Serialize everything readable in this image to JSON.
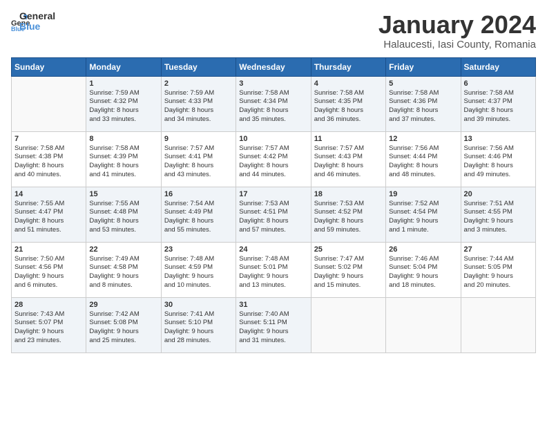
{
  "logo": {
    "text_general": "General",
    "text_blue": "Blue"
  },
  "header": {
    "month": "January 2024",
    "location": "Halaucesti, Iasi County, Romania"
  },
  "weekdays": [
    "Sunday",
    "Monday",
    "Tuesday",
    "Wednesday",
    "Thursday",
    "Friday",
    "Saturday"
  ],
  "weeks": [
    [
      {
        "day": "",
        "info": ""
      },
      {
        "day": "1",
        "info": "Sunrise: 7:59 AM\nSunset: 4:32 PM\nDaylight: 8 hours\nand 33 minutes."
      },
      {
        "day": "2",
        "info": "Sunrise: 7:59 AM\nSunset: 4:33 PM\nDaylight: 8 hours\nand 34 minutes."
      },
      {
        "day": "3",
        "info": "Sunrise: 7:58 AM\nSunset: 4:34 PM\nDaylight: 8 hours\nand 35 minutes."
      },
      {
        "day": "4",
        "info": "Sunrise: 7:58 AM\nSunset: 4:35 PM\nDaylight: 8 hours\nand 36 minutes."
      },
      {
        "day": "5",
        "info": "Sunrise: 7:58 AM\nSunset: 4:36 PM\nDaylight: 8 hours\nand 37 minutes."
      },
      {
        "day": "6",
        "info": "Sunrise: 7:58 AM\nSunset: 4:37 PM\nDaylight: 8 hours\nand 39 minutes."
      }
    ],
    [
      {
        "day": "7",
        "info": "Sunrise: 7:58 AM\nSunset: 4:38 PM\nDaylight: 8 hours\nand 40 minutes."
      },
      {
        "day": "8",
        "info": "Sunrise: 7:58 AM\nSunset: 4:39 PM\nDaylight: 8 hours\nand 41 minutes."
      },
      {
        "day": "9",
        "info": "Sunrise: 7:57 AM\nSunset: 4:41 PM\nDaylight: 8 hours\nand 43 minutes."
      },
      {
        "day": "10",
        "info": "Sunrise: 7:57 AM\nSunset: 4:42 PM\nDaylight: 8 hours\nand 44 minutes."
      },
      {
        "day": "11",
        "info": "Sunrise: 7:57 AM\nSunset: 4:43 PM\nDaylight: 8 hours\nand 46 minutes."
      },
      {
        "day": "12",
        "info": "Sunrise: 7:56 AM\nSunset: 4:44 PM\nDaylight: 8 hours\nand 48 minutes."
      },
      {
        "day": "13",
        "info": "Sunrise: 7:56 AM\nSunset: 4:46 PM\nDaylight: 8 hours\nand 49 minutes."
      }
    ],
    [
      {
        "day": "14",
        "info": "Sunrise: 7:55 AM\nSunset: 4:47 PM\nDaylight: 8 hours\nand 51 minutes."
      },
      {
        "day": "15",
        "info": "Sunrise: 7:55 AM\nSunset: 4:48 PM\nDaylight: 8 hours\nand 53 minutes."
      },
      {
        "day": "16",
        "info": "Sunrise: 7:54 AM\nSunset: 4:49 PM\nDaylight: 8 hours\nand 55 minutes."
      },
      {
        "day": "17",
        "info": "Sunrise: 7:53 AM\nSunset: 4:51 PM\nDaylight: 8 hours\nand 57 minutes."
      },
      {
        "day": "18",
        "info": "Sunrise: 7:53 AM\nSunset: 4:52 PM\nDaylight: 8 hours\nand 59 minutes."
      },
      {
        "day": "19",
        "info": "Sunrise: 7:52 AM\nSunset: 4:54 PM\nDaylight: 9 hours\nand 1 minute."
      },
      {
        "day": "20",
        "info": "Sunrise: 7:51 AM\nSunset: 4:55 PM\nDaylight: 9 hours\nand 3 minutes."
      }
    ],
    [
      {
        "day": "21",
        "info": "Sunrise: 7:50 AM\nSunset: 4:56 PM\nDaylight: 9 hours\nand 6 minutes."
      },
      {
        "day": "22",
        "info": "Sunrise: 7:49 AM\nSunset: 4:58 PM\nDaylight: 9 hours\nand 8 minutes."
      },
      {
        "day": "23",
        "info": "Sunrise: 7:48 AM\nSunset: 4:59 PM\nDaylight: 9 hours\nand 10 minutes."
      },
      {
        "day": "24",
        "info": "Sunrise: 7:48 AM\nSunset: 5:01 PM\nDaylight: 9 hours\nand 13 minutes."
      },
      {
        "day": "25",
        "info": "Sunrise: 7:47 AM\nSunset: 5:02 PM\nDaylight: 9 hours\nand 15 minutes."
      },
      {
        "day": "26",
        "info": "Sunrise: 7:46 AM\nSunset: 5:04 PM\nDaylight: 9 hours\nand 18 minutes."
      },
      {
        "day": "27",
        "info": "Sunrise: 7:44 AM\nSunset: 5:05 PM\nDaylight: 9 hours\nand 20 minutes."
      }
    ],
    [
      {
        "day": "28",
        "info": "Sunrise: 7:43 AM\nSunset: 5:07 PM\nDaylight: 9 hours\nand 23 minutes."
      },
      {
        "day": "29",
        "info": "Sunrise: 7:42 AM\nSunset: 5:08 PM\nDaylight: 9 hours\nand 25 minutes."
      },
      {
        "day": "30",
        "info": "Sunrise: 7:41 AM\nSunset: 5:10 PM\nDaylight: 9 hours\nand 28 minutes."
      },
      {
        "day": "31",
        "info": "Sunrise: 7:40 AM\nSunset: 5:11 PM\nDaylight: 9 hours\nand 31 minutes."
      },
      {
        "day": "",
        "info": ""
      },
      {
        "day": "",
        "info": ""
      },
      {
        "day": "",
        "info": ""
      }
    ]
  ]
}
